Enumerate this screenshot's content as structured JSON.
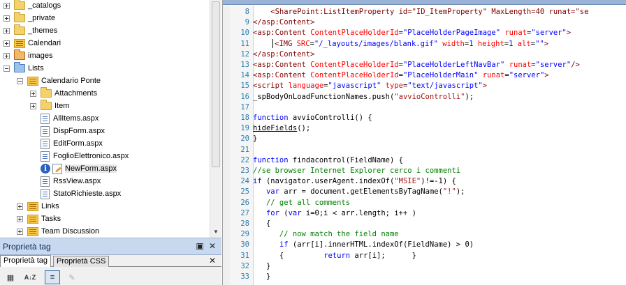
{
  "tree": {
    "items": [
      {
        "label": "_catalogs",
        "expander": "plus",
        "icon": "folder"
      },
      {
        "label": "_private",
        "expander": "plus",
        "icon": "folder"
      },
      {
        "label": "_themes",
        "expander": "plus",
        "icon": "folder"
      },
      {
        "label": "Calendari",
        "expander": "plus",
        "icon": "list-icon"
      },
      {
        "label": "images",
        "expander": "plus",
        "icon": "folder"
      },
      {
        "label": "Lists",
        "expander": "minus",
        "icon": "folder"
      },
      {
        "label": "Calendario Ponte",
        "expander": "minus",
        "icon": "list-icon"
      },
      {
        "label": "Attachments",
        "expander": "plus",
        "icon": "folder"
      },
      {
        "label": "Item",
        "expander": "plus",
        "icon": "folder"
      },
      {
        "label": "AllItems.aspx",
        "expander": "none",
        "icon": "file-icon"
      },
      {
        "label": "DispForm.aspx",
        "expander": "none",
        "icon": "file-icon"
      },
      {
        "label": "EditForm.aspx",
        "expander": "none",
        "icon": "file-icon"
      },
      {
        "label": "FoglioElettronico.aspx",
        "expander": "none",
        "icon": "file-icon"
      },
      {
        "label": "NewForm.aspx",
        "expander": "none",
        "icon": "edit-file-icon"
      },
      {
        "label": "RssView.aspx",
        "expander": "none",
        "icon": "file-icon"
      },
      {
        "label": "StatoRichieste.aspx",
        "expander": "none",
        "icon": "file-icon"
      },
      {
        "label": "Links",
        "expander": "plus",
        "icon": "list-icon"
      },
      {
        "label": "Tasks",
        "expander": "plus",
        "icon": "list-icon"
      },
      {
        "label": "Team Discussion",
        "expander": "plus",
        "icon": "list-icon"
      }
    ]
  },
  "props": {
    "title": "Proprietà tag",
    "tabs": [
      {
        "label": "Proprietà tag",
        "active": true
      },
      {
        "label": "Proprietà CSS",
        "active": false
      }
    ]
  },
  "code": {
    "lines": [
      {
        "n": "8",
        "tokens": [
          {
            "c": "t-tag",
            "t": "    <SharePoint:ListItemProperty id=\"ID_ItemProperty\" MaxLength=40 runat=\"se"
          }
        ]
      },
      {
        "n": "9",
        "tokens": [
          {
            "c": "t-tag",
            "t": "</asp:Content>"
          }
        ]
      },
      {
        "n": "10",
        "tokens": [
          {
            "c": "t-tag",
            "t": "<asp:Content "
          },
          {
            "c": "t-attr",
            "t": "ContentPlaceHolderId"
          },
          {
            "c": "t-txt",
            "t": "="
          },
          {
            "c": "t-val",
            "t": "\"PlaceHolderPageImage\""
          },
          {
            "c": "t-txt",
            "t": " "
          },
          {
            "c": "t-attr",
            "t": "runat"
          },
          {
            "c": "t-txt",
            "t": "="
          },
          {
            "c": "t-val",
            "t": "\"server\""
          },
          {
            "c": "t-tag",
            "t": ">"
          }
        ]
      },
      {
        "n": "11",
        "caret": true,
        "tokens": [
          {
            "c": "t-tag",
            "t": "<IMG "
          },
          {
            "c": "t-attr",
            "t": "SRC"
          },
          {
            "c": "t-txt",
            "t": "="
          },
          {
            "c": "t-val",
            "t": "\"/_layouts/images/blank.gif\""
          },
          {
            "c": "t-txt",
            "t": " "
          },
          {
            "c": "t-attr",
            "t": "width"
          },
          {
            "c": "t-txt",
            "t": "="
          },
          {
            "c": "t-val",
            "t": "1"
          },
          {
            "c": "t-txt",
            "t": " "
          },
          {
            "c": "t-attr",
            "t": "height"
          },
          {
            "c": "t-txt",
            "t": "="
          },
          {
            "c": "t-val",
            "t": "1"
          },
          {
            "c": "t-txt",
            "t": " "
          },
          {
            "c": "t-attr",
            "t": "alt"
          },
          {
            "c": "t-txt",
            "t": "="
          },
          {
            "c": "t-val",
            "t": "\"\""
          },
          {
            "c": "t-tag",
            "t": ">"
          }
        ]
      },
      {
        "n": "12",
        "tokens": [
          {
            "c": "t-tag",
            "t": "</asp:Content>"
          }
        ]
      },
      {
        "n": "13",
        "tokens": [
          {
            "c": "t-tag",
            "t": "<asp:Content "
          },
          {
            "c": "t-attr",
            "t": "ContentPlaceHolderId"
          },
          {
            "c": "t-txt",
            "t": "="
          },
          {
            "c": "t-val",
            "t": "\"PlaceHolderLeftNavBar\""
          },
          {
            "c": "t-txt",
            "t": " "
          },
          {
            "c": "t-attr",
            "t": "runat"
          },
          {
            "c": "t-txt",
            "t": "="
          },
          {
            "c": "t-val",
            "t": "\"server\""
          },
          {
            "c": "t-tag",
            "t": "/>"
          }
        ]
      },
      {
        "n": "14",
        "tokens": [
          {
            "c": "t-tag",
            "t": "<asp:Content "
          },
          {
            "c": "t-attr",
            "t": "ContentPlaceHolderId"
          },
          {
            "c": "t-txt",
            "t": "="
          },
          {
            "c": "t-val",
            "t": "\"PlaceHolderMain\""
          },
          {
            "c": "t-txt",
            "t": " "
          },
          {
            "c": "t-attr",
            "t": "runat"
          },
          {
            "c": "t-txt",
            "t": "="
          },
          {
            "c": "t-val",
            "t": "\"server\""
          },
          {
            "c": "t-tag",
            "t": ">"
          }
        ]
      },
      {
        "n": "15",
        "tokens": [
          {
            "c": "t-tag",
            "t": "<script "
          },
          {
            "c": "t-attr",
            "t": "language"
          },
          {
            "c": "t-txt",
            "t": "="
          },
          {
            "c": "t-val",
            "t": "\"javascript\""
          },
          {
            "c": "t-txt",
            "t": " "
          },
          {
            "c": "t-attr",
            "t": "type"
          },
          {
            "c": "t-txt",
            "t": "="
          },
          {
            "c": "t-val",
            "t": "\"text/javascript\""
          },
          {
            "c": "t-tag",
            "t": ">"
          }
        ]
      },
      {
        "n": "16",
        "tokens": [
          {
            "c": "t-txt",
            "t": "_spBodyOnLoadFunctionNames.push("
          },
          {
            "c": "t-str",
            "t": "\"avvioControlli\""
          },
          {
            "c": "t-txt",
            "t": ");"
          }
        ]
      },
      {
        "n": "17",
        "tokens": []
      },
      {
        "n": "18",
        "tokens": [
          {
            "c": "t-kw",
            "t": "function"
          },
          {
            "c": "t-txt",
            "t": " avvioControlli() {"
          }
        ]
      },
      {
        "n": "19",
        "tokens": [
          {
            "c": "t-txt t-und",
            "t": "hideFields"
          },
          {
            "c": "t-txt",
            "t": "();"
          }
        ]
      },
      {
        "n": "20",
        "tokens": [
          {
            "c": "t-txt",
            "t": "}"
          }
        ]
      },
      {
        "n": "21",
        "tokens": []
      },
      {
        "n": "22",
        "tokens": [
          {
            "c": "t-kw",
            "t": "function"
          },
          {
            "c": "t-txt",
            "t": " findacontrol(FieldName) {"
          }
        ]
      },
      {
        "n": "23",
        "tokens": [
          {
            "c": "t-com",
            "t": "//se browser Internet Explorer cerco i commenti"
          }
        ]
      },
      {
        "n": "24",
        "tokens": [
          {
            "c": "t-kw",
            "t": "if"
          },
          {
            "c": "t-txt",
            "t": " (navigator.userAgent.indexOf("
          },
          {
            "c": "t-str",
            "t": "\"MSIE\""
          },
          {
            "c": "t-txt",
            "t": ")!=-1) {"
          }
        ]
      },
      {
        "n": "25",
        "tokens": [
          {
            "c": "t-txt",
            "t": "   "
          },
          {
            "c": "t-kw",
            "t": "var"
          },
          {
            "c": "t-txt",
            "t": " arr = document.getElementsByTagName("
          },
          {
            "c": "t-str",
            "t": "\"!\""
          },
          {
            "c": "t-txt",
            "t": ");"
          }
        ]
      },
      {
        "n": "26",
        "tokens": [
          {
            "c": "t-com",
            "t": "   // get all comments"
          }
        ]
      },
      {
        "n": "27",
        "tokens": [
          {
            "c": "t-txt",
            "t": "   "
          },
          {
            "c": "t-kw",
            "t": "for"
          },
          {
            "c": "t-txt",
            "t": " ("
          },
          {
            "c": "t-kw",
            "t": "var"
          },
          {
            "c": "t-txt",
            "t": " i=0;i < arr.length; i++ )"
          }
        ]
      },
      {
        "n": "28",
        "tokens": [
          {
            "c": "t-txt",
            "t": "   {"
          }
        ]
      },
      {
        "n": "29",
        "tokens": [
          {
            "c": "t-com",
            "t": "      // now match the field name"
          }
        ]
      },
      {
        "n": "30",
        "tokens": [
          {
            "c": "t-txt",
            "t": "      "
          },
          {
            "c": "t-kw",
            "t": "if"
          },
          {
            "c": "t-txt",
            "t": " (arr[i].innerHTML.indexOf(FieldName) > 0)"
          }
        ]
      },
      {
        "n": "31",
        "tokens": [
          {
            "c": "t-txt",
            "t": "      {         "
          },
          {
            "c": "t-kw",
            "t": "return"
          },
          {
            "c": "t-txt",
            "t": " arr[i];      }"
          }
        ]
      },
      {
        "n": "32",
        "tokens": [
          {
            "c": "t-txt",
            "t": "   }"
          }
        ]
      },
      {
        "n": "33",
        "tokens": [
          {
            "c": "t-txt",
            "t": "   }"
          }
        ]
      }
    ]
  }
}
